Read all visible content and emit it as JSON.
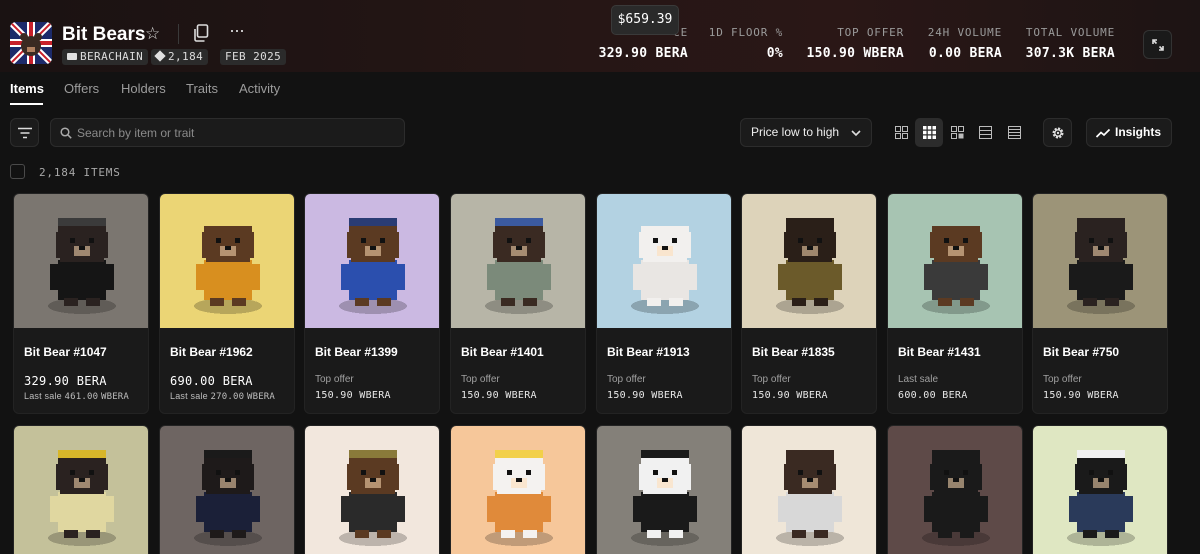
{
  "collection": {
    "name": "Bit Bears",
    "chain": "BERACHAIN",
    "supply": "2,184",
    "date": "FEB 2025"
  },
  "tooltip": "$659.39",
  "stats": [
    {
      "label": "CE",
      "value": "329.90 BERA"
    },
    {
      "label": "1D FLOOR %",
      "value": "0%"
    },
    {
      "label": "TOP OFFER",
      "value": "150.90 WBERA"
    },
    {
      "label": "24H VOLUME",
      "value": "0.00 BERA"
    },
    {
      "label": "TOTAL VOLUME",
      "value": "307.3K BERA"
    }
  ],
  "tabs": [
    "Items",
    "Offers",
    "Holders",
    "Traits",
    "Activity"
  ],
  "search": {
    "placeholder": "Search by item or trait"
  },
  "sort": {
    "label": "Price low to high"
  },
  "insights_label": "Insights",
  "item_count": "2,184 ITEMS",
  "items": [
    {
      "name": "Bit Bear #1047",
      "price": "329.90",
      "price_unit": "BERA",
      "last_sale_label": "Last sale",
      "last_sale_value": "461.00",
      "last_sale_unit": "WBERA",
      "bg": "#7b7670",
      "bear": "#2a2220",
      "outfit": "#151515",
      "hat": "#3b3b3b"
    },
    {
      "name": "Bit Bear #1962",
      "price": "690.00",
      "price_unit": "BERA",
      "last_sale_label": "Last sale",
      "last_sale_value": "270.00",
      "last_sale_unit": "WBERA",
      "bg": "#ebd575",
      "bear": "#5b3a22",
      "outfit": "#d88f1f",
      "hat": "#ebd575"
    },
    {
      "name": "Bit Bear #1399",
      "sub_label": "Top offer",
      "sub_value": "150.90 WBERA",
      "bg": "#cbb9e2",
      "bear": "#5b3a22",
      "outfit": "#2b4fae",
      "hat": "#2a3c74"
    },
    {
      "name": "Bit Bear #1401",
      "sub_label": "Top offer",
      "sub_value": "150.90 WBERA",
      "bg": "#b7b5a7",
      "bear": "#3a2a22",
      "outfit": "#7b8a7a",
      "hat": "#3b5aa0"
    },
    {
      "name": "Bit Bear #1913",
      "sub_label": "Top offer",
      "sub_value": "150.90 WBERA",
      "bg": "#b3d2e2",
      "bear": "#f2f0ee",
      "outfit": "#e9e6e3",
      "hat": "#b3d2e2"
    },
    {
      "name": "Bit Bear #1835",
      "sub_label": "Top offer",
      "sub_value": "150.90 WBERA",
      "bg": "#ddd3ba",
      "bear": "#2a1f18",
      "outfit": "#6b5a2a",
      "hat": "#2a1f18"
    },
    {
      "name": "Bit Bear #1431",
      "sub_label": "Last sale",
      "sub_value": "600.00 BERA",
      "bg": "#a7c4b2",
      "bear": "#5b3a22",
      "outfit": "#3a3a3a",
      "hat": "#a7c4b2"
    },
    {
      "name": "Bit Bear #750",
      "sub_label": "Top offer",
      "sub_value": "150.90 WBERA",
      "bg": "#9c9478",
      "bear": "#2a2220",
      "outfit": "#1a1a1a",
      "hat": "#2a2220"
    }
  ],
  "items_row2": [
    {
      "bg": "#c4c19a",
      "bear": "#2a2220",
      "outfit": "#e0d7a0",
      "hat": "#d7b62a"
    },
    {
      "bg": "#6e6562",
      "bear": "#1e1a1a",
      "outfit": "#1b2038",
      "hat": "#1a1a1a"
    },
    {
      "bg": "#f2e7dd",
      "bear": "#5b3a22",
      "outfit": "#2a2a2a",
      "hat": "#8a7a3a"
    },
    {
      "bg": "#f6c79a",
      "bear": "#f4f2f0",
      "outfit": "#e08a3a",
      "hat": "#f2d04a"
    },
    {
      "bg": "#848079",
      "bear": "#f1f1f1",
      "outfit": "#1a1a1a",
      "hat": "#1a1a1a"
    },
    {
      "bg": "#efe6d8",
      "bear": "#3a2a22",
      "outfit": "#d8d8d8",
      "hat": "#3a2a22"
    },
    {
      "bg": "#5e4a48",
      "bear": "#1a1a1a",
      "outfit": "#1a1a1a",
      "hat": "#1a1a1a"
    },
    {
      "bg": "#dfe7c2",
      "bear": "#1a1a1a",
      "outfit": "#2a3a5a",
      "hat": "#f1f1f1"
    }
  ]
}
